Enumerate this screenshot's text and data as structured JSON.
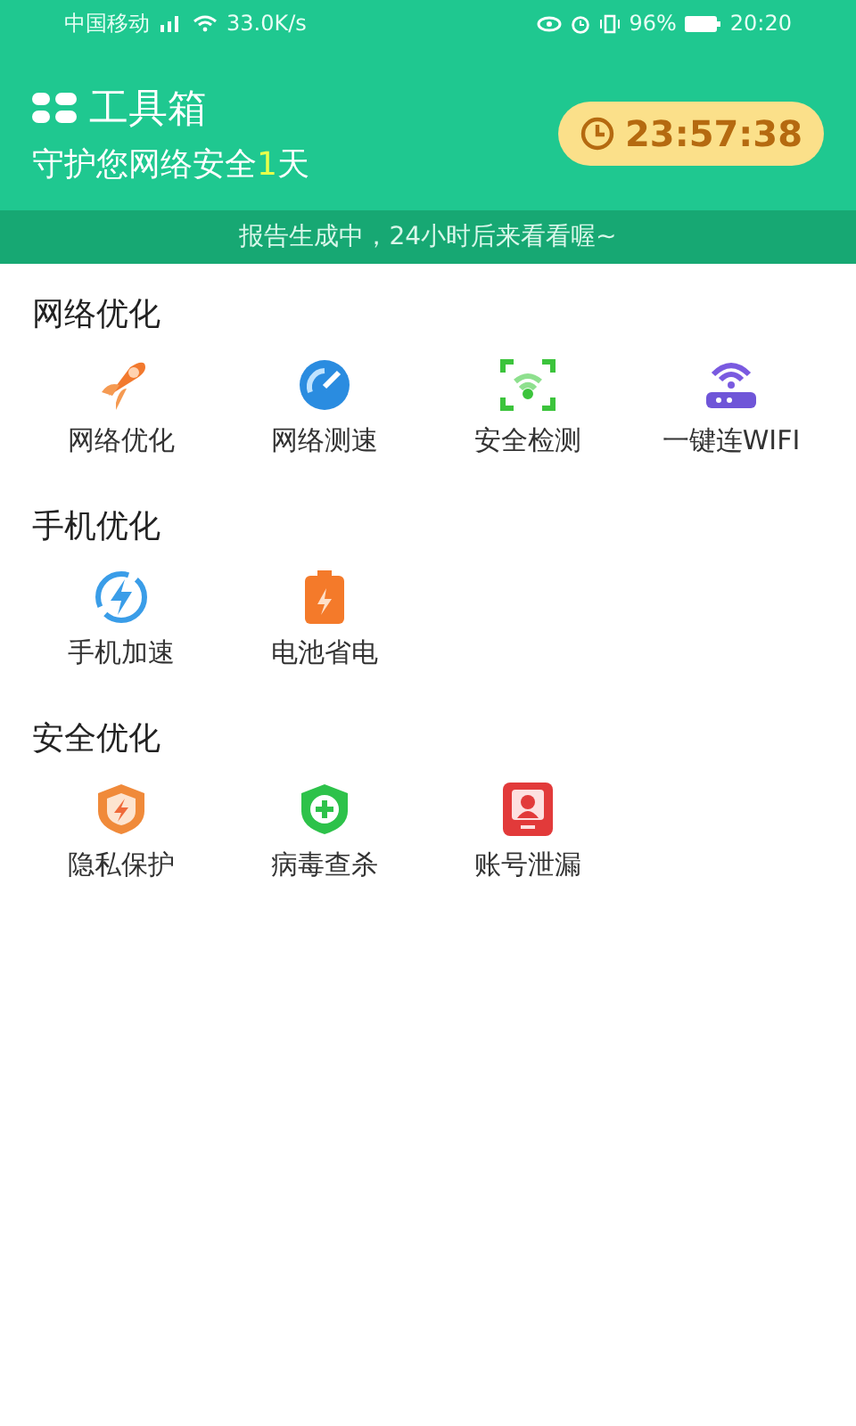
{
  "status_bar": {
    "carrier": "中国移动",
    "speed": "33.0K/s",
    "battery": "96%",
    "time": "20:20"
  },
  "header": {
    "title": "工具箱",
    "subtitle": {
      "before": "守护您网络安全",
      "days": "1",
      "after": "天"
    },
    "timer": "23:57:38"
  },
  "notice": "报告生成中，24小时后来看看喔~",
  "sections": [
    {
      "title": "网络优化",
      "tools": [
        {
          "kind": "rocket",
          "label": "网络优化"
        },
        {
          "kind": "gauge",
          "label": "网络测速"
        },
        {
          "kind": "scan",
          "label": "安全检测"
        },
        {
          "kind": "router",
          "label": "一键连WIFI"
        }
      ]
    },
    {
      "title": "手机优化",
      "tools": [
        {
          "kind": "boost",
          "label": "手机加速"
        },
        {
          "kind": "battery",
          "label": "电池省电"
        }
      ]
    },
    {
      "title": "安全优化",
      "tools": [
        {
          "kind": "privacy",
          "label": "隐私保护"
        },
        {
          "kind": "antivirus",
          "label": "病毒查杀"
        },
        {
          "kind": "account",
          "label": "账号泄漏"
        }
      ]
    }
  ]
}
